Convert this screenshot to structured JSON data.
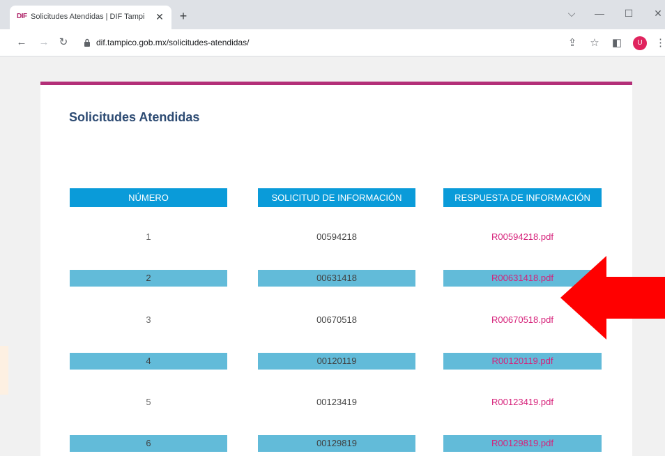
{
  "browser": {
    "tab_favicon": "DIF",
    "tab_title": "Solicitudes Atendidas | DIF Tampi",
    "url": "dif.tampico.gob.mx/solicitudes-atendidas/",
    "profile_initial": "U"
  },
  "page": {
    "title": "Solicitudes Atendidas",
    "table": {
      "headers": [
        "NÚMERO",
        "SOLICITUD DE INFORMACIÓN",
        "RESPUESTA DE INFORMACIÓN"
      ],
      "rows": [
        {
          "numero": "1",
          "solicitud": "00594218",
          "respuesta": "R00594218.pdf"
        },
        {
          "numero": "2",
          "solicitud": "00631418",
          "respuesta": "R00631418.pdf"
        },
        {
          "numero": "3",
          "solicitud": "00670518",
          "respuesta": "R00670518.pdf"
        },
        {
          "numero": "4",
          "solicitud": "00120119",
          "respuesta": "R00120119.pdf"
        },
        {
          "numero": "5",
          "solicitud": "00123419",
          "respuesta": "R00123419.pdf"
        },
        {
          "numero": "6",
          "solicitud": "00129819",
          "respuesta": "R00129819.pdf"
        }
      ]
    }
  },
  "colors": {
    "accent_bar": "#b32f78",
    "header_bg": "#0a9bd9",
    "stripe_bg": "#62bbd9",
    "link": "#d6217a",
    "title": "#2c4a72",
    "annotation_arrow": "#ff0000"
  }
}
